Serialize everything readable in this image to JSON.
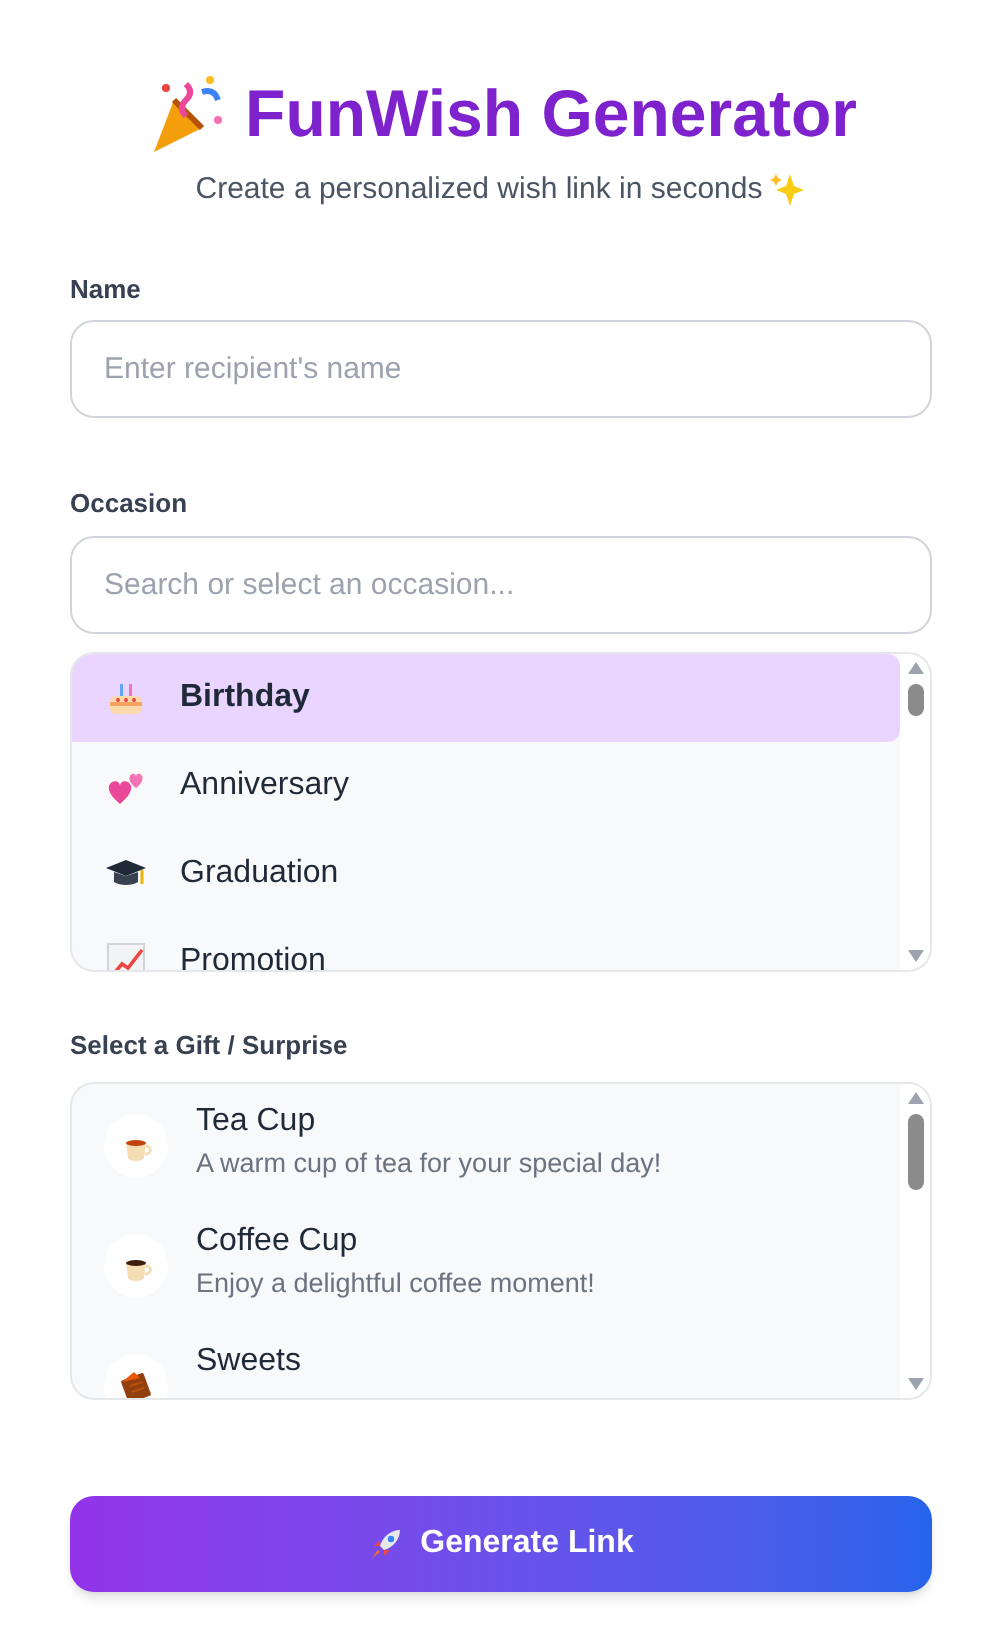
{
  "header": {
    "title": "FunWish Generator",
    "subtitle": "Create a personalized wish link in seconds"
  },
  "name_field": {
    "label": "Name",
    "placeholder": "Enter recipient's name"
  },
  "occasion_field": {
    "label": "Occasion",
    "placeholder": "Search or select an occasion..."
  },
  "occasions": [
    {
      "kind": "cake",
      "label": "Birthday",
      "selected": true
    },
    {
      "kind": "hearts",
      "label": "Anniversary",
      "selected": false
    },
    {
      "kind": "cap",
      "label": "Graduation",
      "selected": false
    },
    {
      "kind": "chart",
      "label": "Promotion",
      "selected": false
    }
  ],
  "gift_label": "Select a Gift / Surprise",
  "gifts": [
    {
      "kind": "tea",
      "title": "Tea Cup",
      "description": "A warm cup of tea for your special day!"
    },
    {
      "kind": "coffee",
      "title": "Coffee Cup",
      "description": "Enjoy a delightful coffee moment!"
    },
    {
      "kind": "sweets",
      "title": "Sweets"
    }
  ],
  "button": {
    "label": "Generate Link"
  }
}
